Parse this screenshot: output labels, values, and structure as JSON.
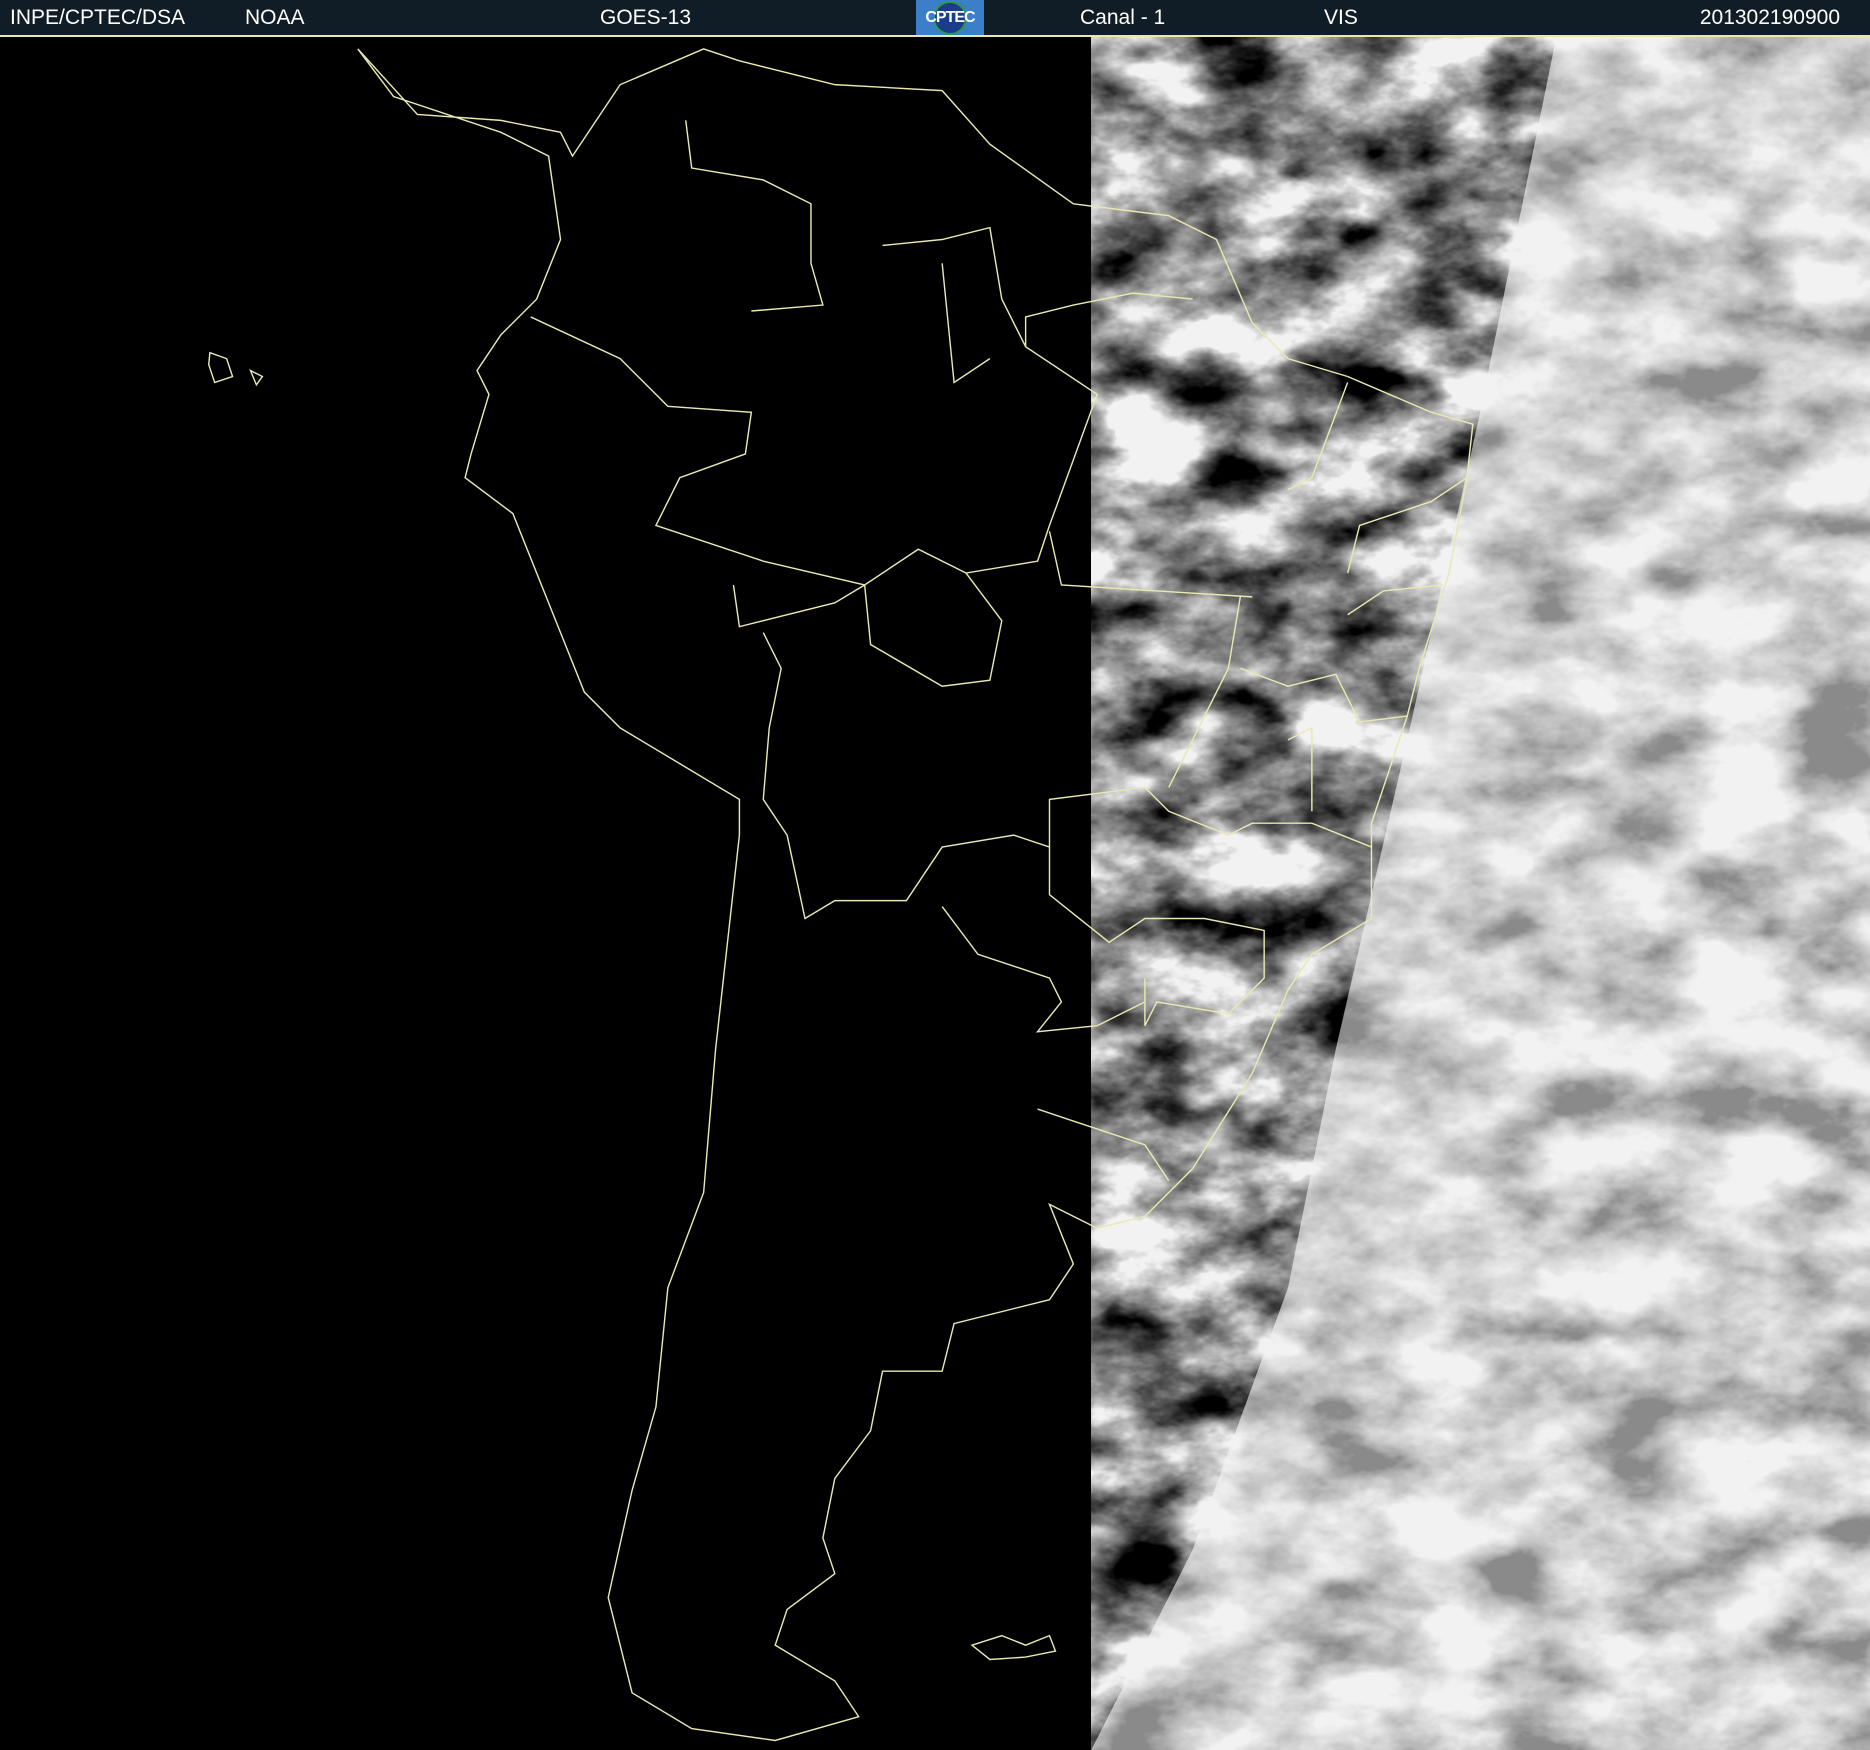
{
  "header": {
    "institution": "INPE/CPTEC/DSA",
    "agency": "NOAA",
    "satellite": "GOES-13",
    "logo_text": "CPTEC",
    "channel": "Canal - 1",
    "band": "VIS",
    "timestamp": "201302190900"
  },
  "colors": {
    "header_bg": "#111d26",
    "borders": "#e8e8b0",
    "night": "#000000",
    "clouds": "#c8c8c8"
  }
}
